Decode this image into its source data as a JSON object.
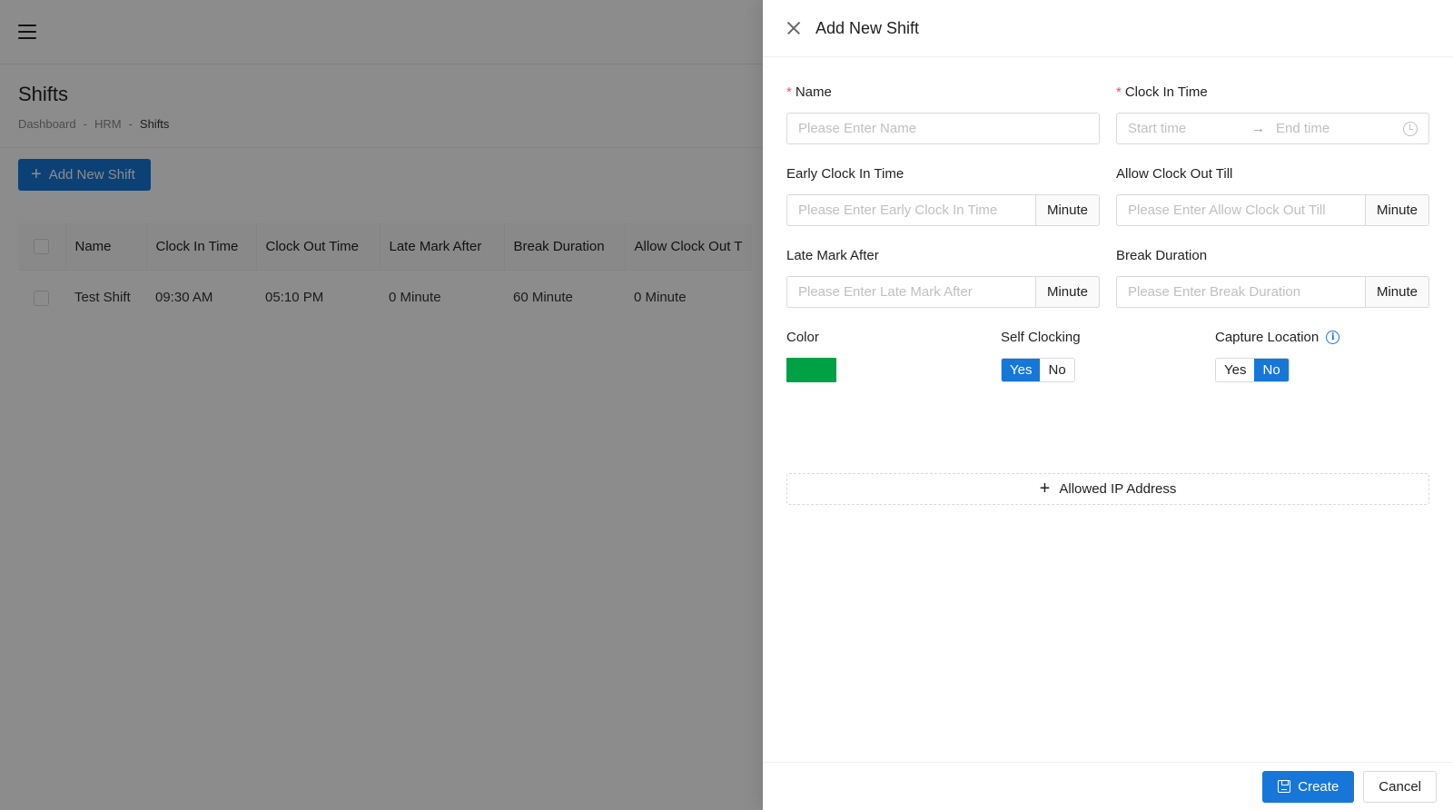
{
  "page": {
    "title": "Shifts",
    "breadcrumb": [
      "Dashboard",
      "HRM",
      "Shifts"
    ],
    "breadcrumb_sep": "-",
    "add_button_label": "Add New Shift"
  },
  "table": {
    "columns": [
      "Name",
      "Clock In Time",
      "Clock Out Time",
      "Late Mark After",
      "Break Duration",
      "Allow Clock Out T"
    ],
    "rows": [
      [
        "Test Shift",
        "09:30 AM",
        "05:10 PM",
        "0 Minute",
        "60 Minute",
        "0 Minute"
      ]
    ]
  },
  "drawer": {
    "title": "Add New Shift",
    "name": {
      "label": "Name",
      "placeholder": "Please Enter Name",
      "required_mark": "*"
    },
    "clock_in": {
      "label": "Clock In Time",
      "start_placeholder": "Start time",
      "end_placeholder": "End time",
      "required_mark": "*"
    },
    "early_clock_in": {
      "label": "Early Clock In Time",
      "placeholder": "Please Enter Early Clock In Time",
      "unit": "Minute"
    },
    "allow_clock_out": {
      "label": "Allow Clock Out Till",
      "placeholder": "Please Enter Allow Clock Out Till",
      "unit": "Minute"
    },
    "late_mark": {
      "label": "Late Mark After",
      "placeholder": "Please Enter Late Mark After",
      "unit": "Minute"
    },
    "break_duration": {
      "label": "Break Duration",
      "placeholder": "Please Enter Break Duration",
      "unit": "Minute"
    },
    "color": {
      "label": "Color",
      "value": "#00a044"
    },
    "self_clocking": {
      "label": "Self Clocking",
      "yes": "Yes",
      "no": "No",
      "selected": "Yes"
    },
    "capture_location": {
      "label": "Capture Location",
      "yes": "Yes",
      "no": "No",
      "selected": "No"
    },
    "allowed_ip_label": "Allowed IP Address",
    "create_label": "Create",
    "cancel_label": "Cancel"
  },
  "colors": {
    "primary": "#1677d8",
    "required": "#ff4d4f"
  }
}
